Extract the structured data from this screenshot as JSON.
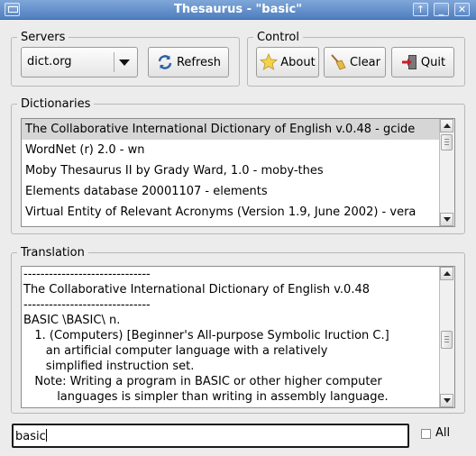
{
  "window": {
    "title": "Thesaurus - \"basic\""
  },
  "servers": {
    "legend": "Servers",
    "selected": "dict.org",
    "refresh_label": "Refresh"
  },
  "control": {
    "legend": "Control",
    "about_label": "About",
    "clear_label": "Clear",
    "quit_label": "Quit"
  },
  "dictionaries": {
    "legend": "Dictionaries",
    "items": [
      "The Collaborative International Dictionary of English v.0.48 - gcide",
      "WordNet (r) 2.0 - wn",
      "Moby Thesaurus II by Grady Ward, 1.0 - moby-thes",
      "Elements database 20001107 - elements",
      "Virtual Entity of Relevant Acronyms (Version 1.9, June 2002) - vera"
    ],
    "selected_index": 0
  },
  "translation": {
    "legend": "Translation",
    "lines": [
      "------------------------------",
      "The Collaborative International Dictionary of English v.0.48",
      "------------------------------",
      "BASIC \\BASIC\\ n.",
      "   1. (Computers) [Beginner's All-purpose Symbolic Iruction C.]",
      "      an artificial computer language with a relatively",
      "      simplified instruction set.",
      "   Note: Writing a program in BASIC or other higher computer",
      "         languages is simpler than writing in assembly language."
    ]
  },
  "search": {
    "value": "basic"
  },
  "all_option": {
    "label": "All",
    "checked": false
  },
  "icons": {
    "refresh": "refresh-icon",
    "about": "star-icon",
    "clear": "broom-icon",
    "quit": "exit-door-icon"
  }
}
